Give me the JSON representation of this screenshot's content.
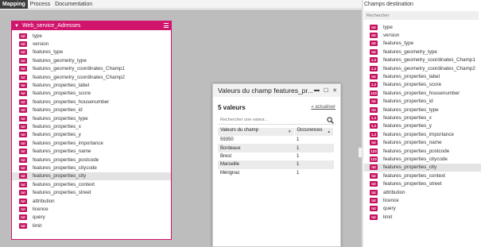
{
  "tabs": [
    "Mapping",
    "Process",
    "Documentation"
  ],
  "source": {
    "title": "Web_service_Adresses",
    "fields": [
      {
        "type": "txt",
        "name": "type"
      },
      {
        "type": "txt",
        "name": "version"
      },
      {
        "type": "txt",
        "name": "features_type"
      },
      {
        "type": "txt",
        "name": "features_geometry_type"
      },
      {
        "type": "txt",
        "name": "features_geometry_coordinates_Champ1"
      },
      {
        "type": "txt",
        "name": "features_geometry_coordinates_Champ2"
      },
      {
        "type": "txt",
        "name": "features_properties_label"
      },
      {
        "type": "txt",
        "name": "features_properties_score"
      },
      {
        "type": "txt",
        "name": "features_properties_housenumber"
      },
      {
        "type": "txt",
        "name": "features_properties_id"
      },
      {
        "type": "txt",
        "name": "features_properties_type"
      },
      {
        "type": "txt",
        "name": "features_properties_x"
      },
      {
        "type": "txt",
        "name": "features_properties_y"
      },
      {
        "type": "txt",
        "name": "features_properties_importance"
      },
      {
        "type": "txt",
        "name": "features_properties_name"
      },
      {
        "type": "txt",
        "name": "features_properties_postcode"
      },
      {
        "type": "txt",
        "name": "features_properties_citycode"
      },
      {
        "type": "txt",
        "name": "features_properties_city",
        "selected": true
      },
      {
        "type": "txt",
        "name": "features_properties_context"
      },
      {
        "type": "txt",
        "name": "features_properties_street"
      },
      {
        "type": "txt",
        "name": "attribution"
      },
      {
        "type": "txt",
        "name": "licence"
      },
      {
        "type": "txt",
        "name": "query"
      },
      {
        "type": "txt",
        "name": "limit"
      }
    ]
  },
  "dialog": {
    "title": "Valeurs du champ features_pr...",
    "count": "5 valeurs",
    "refresh": "« actualiser",
    "search_placeholder": "Rechercher une valeur...",
    "headers": [
      "Valeurs du champ",
      "Occurences"
    ],
    "rows": [
      [
        "59350",
        "1"
      ],
      [
        "Bordeaux",
        "1"
      ],
      [
        "Brest",
        "1"
      ],
      [
        "Marseille",
        "1"
      ],
      [
        "Mérignac",
        "1"
      ]
    ]
  },
  "destination": {
    "title": "Champs destination",
    "search_placeholder": "Rechercher",
    "fields": [
      {
        "type": "txt",
        "name": "type"
      },
      {
        "type": "txt",
        "name": "version"
      },
      {
        "type": "txt",
        "name": "features_type"
      },
      {
        "type": "txt",
        "name": "features_geometry_type"
      },
      {
        "type": "1.2",
        "name": "features_geometry_coordinates_Champ1"
      },
      {
        "type": "1.2",
        "name": "features_geometry_coordinates_Champ2"
      },
      {
        "type": "txt",
        "name": "features_properties_label"
      },
      {
        "type": "1.2",
        "name": "features_properties_score"
      },
      {
        "type": "123",
        "name": "features_properties_housenumber"
      },
      {
        "type": "txt",
        "name": "features_properties_id"
      },
      {
        "type": "txt",
        "name": "features_properties_type"
      },
      {
        "type": "1.2",
        "name": "features_properties_x"
      },
      {
        "type": "1.2",
        "name": "features_properties_y"
      },
      {
        "type": "1.2",
        "name": "features_properties_importance"
      },
      {
        "type": "txt",
        "name": "features_properties_name"
      },
      {
        "type": "123",
        "name": "features_properties_postcode"
      },
      {
        "type": "123",
        "name": "features_properties_citycode"
      },
      {
        "type": "txt",
        "name": "features_properties_city",
        "selected": true
      },
      {
        "type": "txt",
        "name": "features_properties_context"
      },
      {
        "type": "txt",
        "name": "features_properties_street"
      },
      {
        "type": "txt",
        "name": "attribution"
      },
      {
        "type": "txt",
        "name": "licence"
      },
      {
        "type": "txt",
        "name": "query"
      },
      {
        "type": "txt",
        "name": "limit"
      }
    ]
  },
  "colors": {
    "accent": "#d1156d",
    "badge": "#c5115f",
    "canvas": "#bdbdbd"
  }
}
